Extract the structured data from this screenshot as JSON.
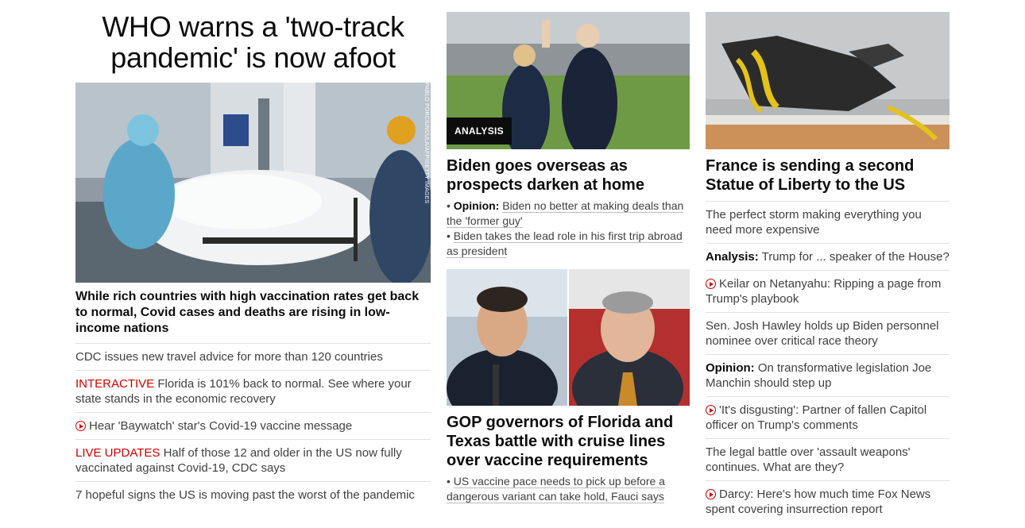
{
  "col1": {
    "headline": "WHO warns a 'two-track pandemic' is now afoot",
    "photo_credit": "PABLO PORCIUNCULA/AFP/GETTY IMAGES",
    "lead": "While rich countries with high vaccination rates get back to normal, Covid cases and deaths are rising in low-income nations",
    "items": [
      {
        "text": "CDC issues new travel advice for more than 120 countries"
      },
      {
        "tag": "INTERACTIVE",
        "text": "Florida is 101% back to normal. See where your state stands in the economic recovery"
      },
      {
        "text": "Hear 'Baywatch' star's Covid-19 vaccine message"
      },
      {
        "tag": "LIVE UPDATES",
        "text": "Half of those 12 and older in the US now fully vaccinated against Covid-19, CDC says"
      },
      {
        "text": "7 hopeful signs the US is moving past the worst of the pandemic"
      }
    ]
  },
  "col2": {
    "story1": {
      "badge": "ANALYSIS",
      "title": "Biden goes overseas as prospects darken at home",
      "sub1_label": "Opinion:",
      "sub1_text": "Biden no better at making deals than the 'former guy'",
      "sub2_text": "Biden takes the lead role in his first trip abroad as president"
    },
    "story2": {
      "title": "GOP governors of Florida and Texas battle with cruise lines over vaccine requirements",
      "sub1_text": "US vaccine pace needs to pick up before a dangerous variant can take hold, Fauci says"
    }
  },
  "col3": {
    "title": "France is sending a second Statue of Liberty to the US",
    "items": [
      {
        "text": "The perfect storm making everything you need more expensive"
      },
      {
        "label": "Analysis:",
        "text": " Trump for ... speaker of the House?"
      },
      {
        "text": "Keilar on Netanyahu: Ripping a page from Trump's playbook"
      },
      {
        "text": "Sen. Josh Hawley holds up Biden personnel nominee over critical race theory"
      },
      {
        "label": "Opinion:",
        "text": " On transformative legislation Joe Manchin should step up"
      },
      {
        "text": "'It's disgusting': Partner of fallen Capitol officer on Trump's comments"
      },
      {
        "text": "The legal battle over 'assault weapons' continues. What are they?"
      },
      {
        "text": "Darcy: Here's how much time Fox News spent covering insurrection report"
      }
    ]
  },
  "colors": {
    "accent_red": "#cc0000",
    "text_dark": "#0c0c0c",
    "divider": "#e1e1e1"
  }
}
